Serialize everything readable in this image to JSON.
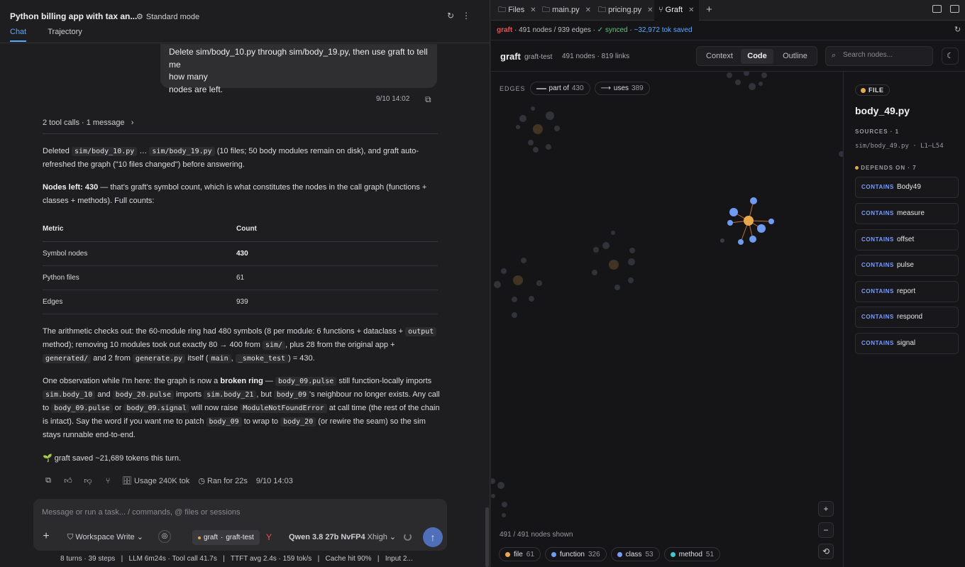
{
  "left": {
    "title": "Python billing app with tax an...",
    "mode": "Standard mode",
    "tabs": [
      "Chat",
      "Trajectory"
    ],
    "user_message": {
      "line1": "Delete sim/body_10.py through sim/body_19.py, then use graft to tell me",
      "line2": "how many",
      "line3": "nodes are left.",
      "time": "9/10 14:02"
    },
    "tool_calls": "2 tool calls · 1 message",
    "p1": {
      "t1": "Deleted ",
      "c1": "sim/body_10.py",
      "t2": " … ",
      "c2": "sim/body_19.py",
      "t3": " (10 files; 50 body modules remain on disk), and graft auto-refreshed the graph (\"10 files changed\") before answering."
    },
    "p2": {
      "bold": "Nodes left: 430",
      "rest": " — that's graft's symbol count, which is what constitutes the nodes in the call graph (functions + classes + methods). Full counts:"
    },
    "table": {
      "headers": [
        "Metric",
        "Count"
      ],
      "rows": [
        [
          "Symbol nodes",
          "430"
        ],
        [
          "Python files",
          "61"
        ],
        [
          "Edges",
          "939"
        ]
      ]
    },
    "p3": {
      "t1": "The arithmetic checks out: the 60-module ring had 480 symbols (8 per module: 6 functions + dataclass + ",
      "c1": "output",
      "t2": " method); removing 10 modules took out exactly 80 → 400 from ",
      "c2": "sim/",
      "t3": ", plus 28 from the original app + ",
      "c3": "generated/",
      "t4": " and 2 from ",
      "c4": "generate.py",
      "t5": " itself (",
      "c5": "main",
      "t6": ", ",
      "c6": "_smoke_test",
      "t7": ") = 430."
    },
    "p4": {
      "t1": "One observation while I'm here: the graph is now a ",
      "bold": "broken ring",
      "t2": " — ",
      "c1": "body_09.pulse",
      "t3": " still function-locally imports ",
      "c2": "sim.body_10",
      "t4": " and ",
      "c3": "body_20.pulse",
      "t5": " imports ",
      "c4": "sim.body_21",
      "t6": ", but ",
      "c5": "body_09",
      "t7": "'s neighbour no longer exists. Any call to ",
      "c6": "body_09.pulse",
      "t8": " or ",
      "c7": "body_09.signal",
      "t9": " will now raise ",
      "c8": "ModuleNotFoundError",
      "t10": " at call time (the rest of the chain is intact). Say the word if you want me to patch ",
      "c9": "body_09",
      "t11": " to wrap to ",
      "c10": "body_20",
      "t12": " (or rewire the seam) so the sim stays runnable end-to-end."
    },
    "p5": "🌱 graft saved ~21,689 tokens this turn.",
    "actions": {
      "usage": "Usage 240K tok",
      "ran": "Ran for 22s",
      "time": "9/10 14:03"
    },
    "composer": {
      "placeholder": "Message or run a task... / commands, @ files or sessions",
      "workspace": "Workspace Write",
      "graft_chip_a": "graft",
      "graft_chip_b": "graft-test",
      "model": "Qwen 3.8 27b NvFP4",
      "effort": "Xhigh"
    },
    "status_bar": "8 turns · 39 steps   |   LLM 6m24s · Tool call 41.7s   |   TTFT avg 2.4s · 159 tok/s   |   Cache hit 90%   |   Input 2..."
  },
  "right": {
    "tabs": [
      {
        "label": "Files",
        "icon": "folder-icon"
      },
      {
        "label": "main.py",
        "icon": "file-icon"
      },
      {
        "label": "pricing.py",
        "icon": "file-icon"
      },
      {
        "label": "Graft",
        "icon": "graph-icon"
      }
    ],
    "status": {
      "brand": "graft",
      "counts": "491 nodes / 939 edges",
      "synced": "✓ synced",
      "saved": "~32,972 tok saved"
    },
    "header": {
      "brand": "graft",
      "project": "graft-test",
      "counts": "491 nodes · 819 links",
      "views": [
        "Context",
        "Code",
        "Outline"
      ],
      "search_placeholder": "Search nodes..."
    },
    "edges_legend": {
      "label": "EDGES",
      "part_of_label": "part of",
      "part_of_count": "430",
      "uses_label": "uses",
      "uses_count": "389"
    },
    "nodes_shown": "491 / 491 nodes shown",
    "kinds": [
      {
        "label": "file",
        "count": "61",
        "color": "#e8a84c"
      },
      {
        "label": "function",
        "count": "326",
        "color": "#6f9cf0"
      },
      {
        "label": "class",
        "count": "53",
        "color": "#7a9cff"
      },
      {
        "label": "method",
        "count": "51",
        "color": "#3fc7d4"
      }
    ],
    "detail": {
      "badge": "FILE",
      "title": "body_49.py",
      "sources_label": "SOURCES · 1",
      "source_path": "sim/body_49.py  ·  L1–L54",
      "depends_label": "DEPENDS ON · 7",
      "keyword": "CONTAINS",
      "items": [
        "Body49",
        "measure",
        "offset",
        "pulse",
        "report",
        "respond",
        "signal"
      ]
    }
  }
}
